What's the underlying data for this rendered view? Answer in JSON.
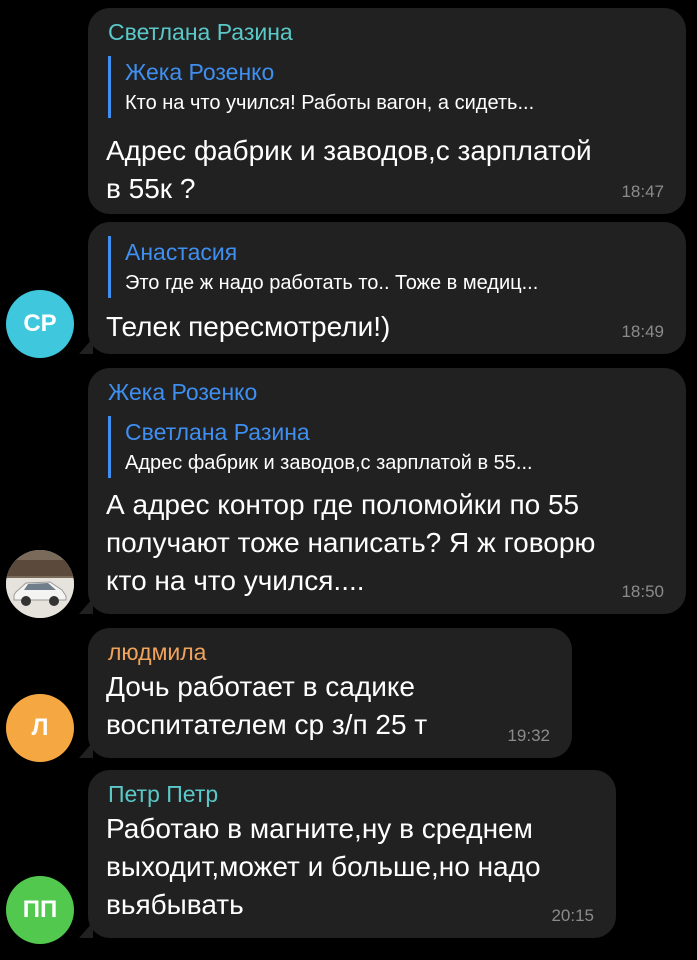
{
  "messages": [
    {
      "sender": "Светлана Разина",
      "sender_color": "#5ac8c8",
      "reply_to": {
        "name": "Жека Розенко",
        "text": "Кто на что учился! Работы вагон, а сидеть..."
      },
      "text": "Адрес фабрик и заводов,с зарплатой\nв 55к ?",
      "time": "18:47"
    },
    {
      "reply_to": {
        "name": "Анастасия",
        "text": "Это где ж надо работать то.. Тоже в медиц..."
      },
      "text": "Телек пересмотрели!)",
      "time": "18:49",
      "avatar": {
        "initials": "СР",
        "color": "#3fc7dd"
      }
    },
    {
      "sender": "Жека Розенко",
      "sender_color": "#3f8ff0",
      "reply_to": {
        "name": "Светлана Разина",
        "text": "Адрес фабрик и заводов,с зарплатой в 55..."
      },
      "text": "А адрес контор где поломойки по 55\nполучают тоже написать? Я ж говорю\nкто на что учился....",
      "time": "18:50",
      "avatar": {
        "image": "car-photo"
      }
    },
    {
      "sender": "людмила",
      "sender_color": "#f0a35a",
      "text": "Дочь работает в садике\nвоспитателем ср  з/п  25 т",
      "time": "19:32",
      "avatar": {
        "initials": "Л",
        "color": "#f5a742"
      }
    },
    {
      "sender": "Петр Петр",
      "sender_color": "#5ac8c8",
      "text": "Работаю в магните,ну в среднем\nвыходит,может и больше,но надо\nвьябывать",
      "time": "20:15",
      "avatar": {
        "initials": "ПП",
        "color": "#52c94e"
      }
    }
  ]
}
